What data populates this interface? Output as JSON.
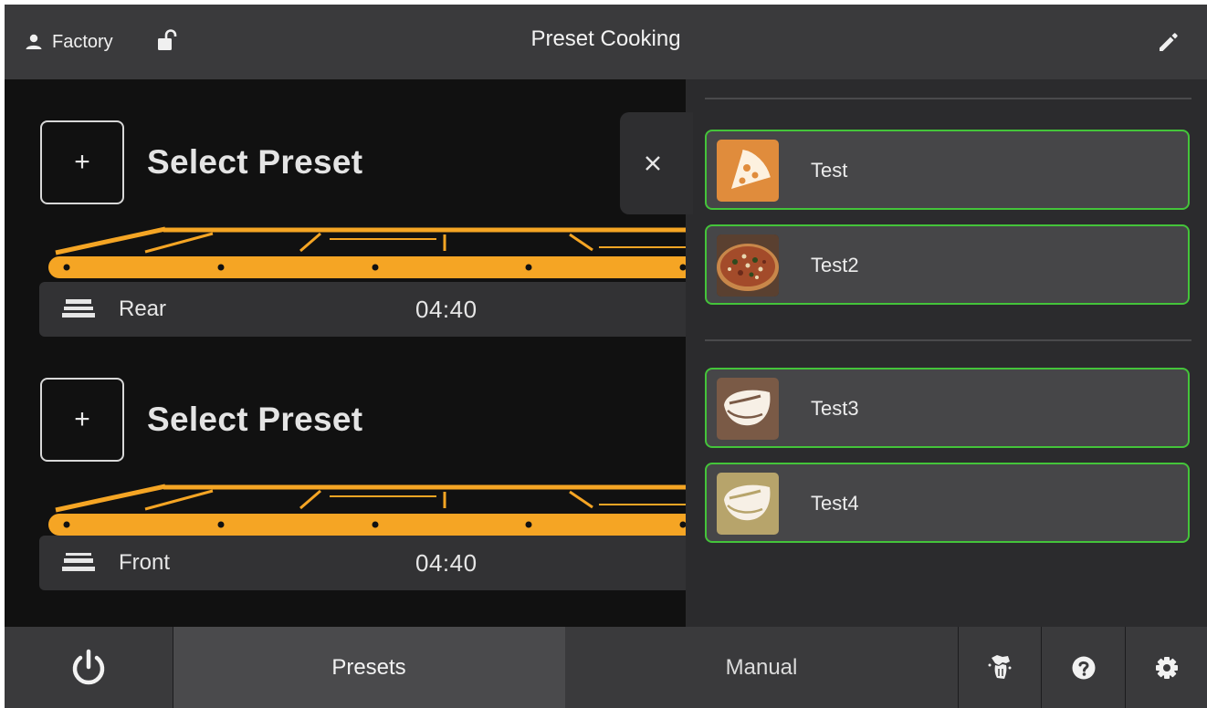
{
  "header": {
    "user_label": "Factory",
    "title": "Preset Cooking"
  },
  "lanes": [
    {
      "select_label": "Select Preset",
      "select_symbol": "+",
      "lane_name": "Rear",
      "time": "04:40"
    },
    {
      "select_label": "Select Preset",
      "select_symbol": "+",
      "lane_name": "Front",
      "time": "04:40"
    }
  ],
  "close_symbol": "×",
  "presets": [
    {
      "name": "Test",
      "icon": "pizza-slice-icon",
      "color": "#e08c3c"
    },
    {
      "name": "Test2",
      "icon": "pizza-photo",
      "color": "#6b4a2a"
    },
    {
      "name": "Test3",
      "icon": "steak-icon",
      "color": "#7a5a46"
    },
    {
      "name": "Test4",
      "icon": "steak-icon",
      "color": "#b7a46b"
    }
  ],
  "nav": {
    "presets_label": "Presets",
    "manual_label": "Manual"
  },
  "colors": {
    "accent_green": "#44c43a",
    "conveyor_orange": "#f5a524",
    "top_bar": "#3a3a3c",
    "panel": "#2b2b2d"
  }
}
